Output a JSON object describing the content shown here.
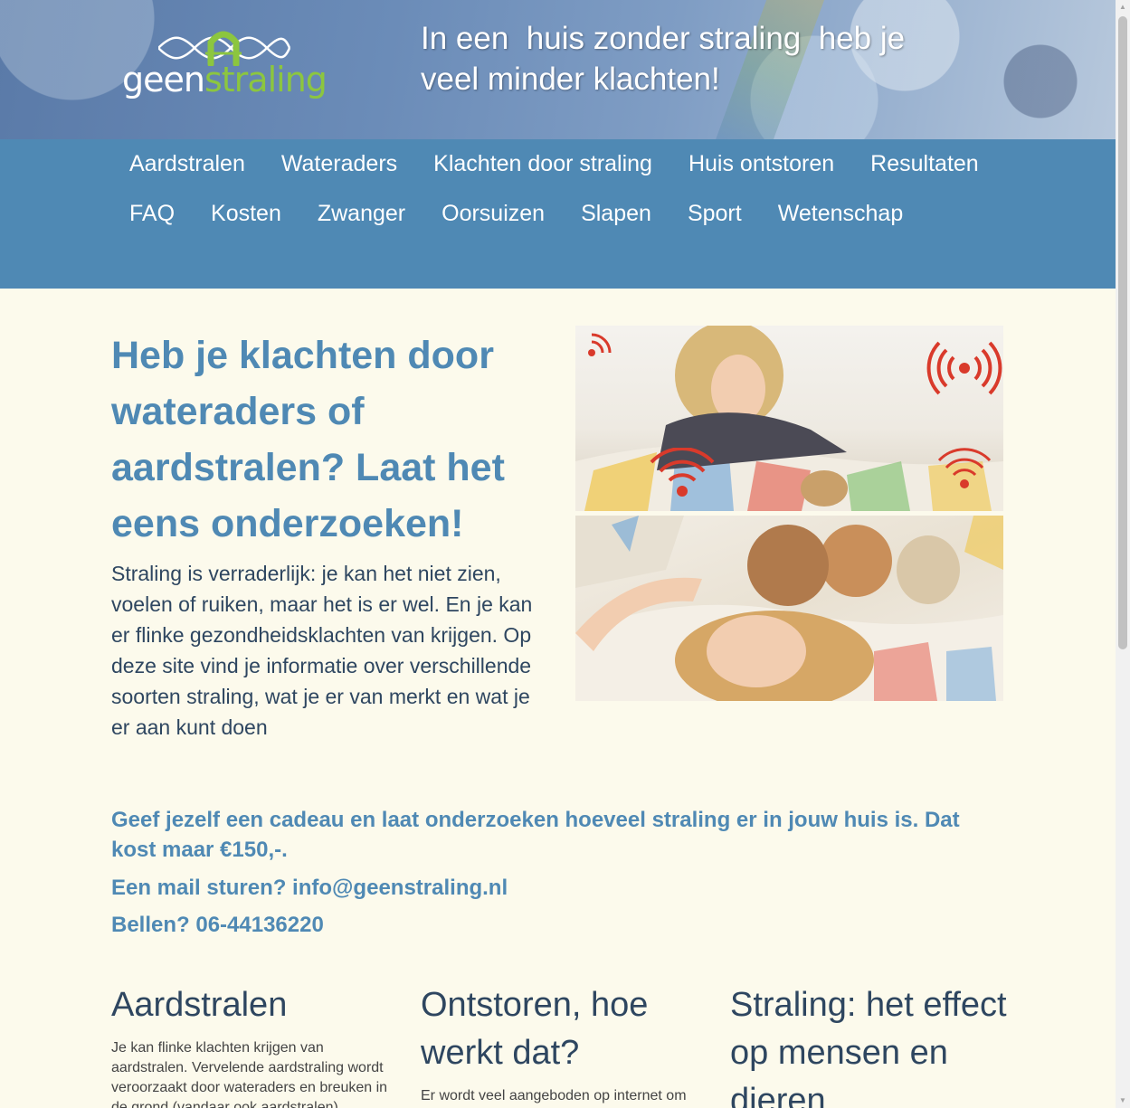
{
  "header": {
    "logo": {
      "part1": "geen",
      "part2": "straling"
    },
    "tagline": "In een  huis zonder straling  heb je\nveel minder klachten!"
  },
  "nav": {
    "items": [
      {
        "label": "Aardstralen"
      },
      {
        "label": "Wateraders"
      },
      {
        "label": "Klachten door straling"
      },
      {
        "label": "Huis ontstoren"
      },
      {
        "label": "Resultaten"
      },
      {
        "label": "FAQ"
      },
      {
        "label": "Kosten"
      },
      {
        "label": "Zwanger"
      },
      {
        "label": "Oorsuizen"
      },
      {
        "label": "Slapen"
      },
      {
        "label": "Sport"
      },
      {
        "label": "Wetenschap"
      }
    ]
  },
  "main": {
    "headline": "Heb je klachten door wateraders of aardstralen? Laat het eens onderzoeken!",
    "intro": "Straling is verraderlijk: je kan het niet zien, voelen of ruiken, maar het is er wel. En je kan er flinke gezondheidsklachten van krijgen. Op deze site vind je informatie over verschillende soorten straling, wat je er van merkt en wat je er aan kunt doen",
    "cta_offer": "Geef jezelf een cadeau en laat onderzoeken hoeveel straling er in jouw huis is.  Dat kost maar €150,-.",
    "cta_mail": "Een mail sturen? info@geenstraling.nl",
    "cta_phone": "Bellen? 06-44136220"
  },
  "columns": [
    {
      "title": "Aardstralen",
      "text": "Je kan flinke klachten krijgen van aardstralen. Vervelende aardstraling wordt veroorzaakt door wateraders en breuken in de grond (vandaar ook aardstralen)."
    },
    {
      "title": "Ontstoren, hoe werkt dat?",
      "text": "Er wordt veel aangeboden op internet om"
    },
    {
      "title": "Straling: het effect op mensen en dieren",
      "text": ""
    }
  ],
  "colors": {
    "nav_bg": "#4f89b4",
    "accent": "#4f89b4",
    "logo_green": "#8cc63f",
    "radiation_red": "#d93a2b",
    "page_bg": "#fcfaec"
  },
  "icons": [
    "radiation-signal-icon",
    "scroll-up-arrow-icon",
    "scroll-down-arrow-icon"
  ]
}
